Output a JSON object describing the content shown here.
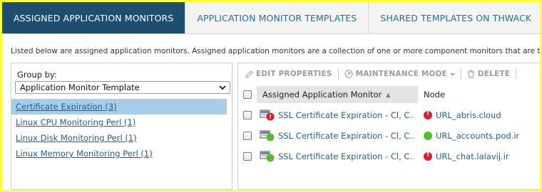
{
  "tabs": [
    {
      "label": "ASSIGNED APPLICATION MONITORS",
      "active": true
    },
    {
      "label": "APPLICATION MONITOR TEMPLATES",
      "active": false
    },
    {
      "label": "SHARED TEMPLATES ON THWACK",
      "active": false
    }
  ],
  "description": "Listed below are assigned application monitors. Assigned application monitors are a collection of one or more component monitors that are treat",
  "group_by": {
    "label": "Group by:",
    "selected": "Application Monitor Template",
    "items": [
      {
        "label": "Certificate Expiration (3)",
        "selected": true
      },
      {
        "label": "Linux CPU Monitoring Perl (1)",
        "selected": false
      },
      {
        "label": "Linux Disk Monitoring Perl (1)",
        "selected": false
      },
      {
        "label": "Linux Memory Monitoring Perl (1)",
        "selected": false
      }
    ]
  },
  "toolbar": {
    "edit_properties": "EDIT PROPERTIES",
    "maintenance_mode": "MAINTENANCE MODE",
    "delete": "DELETE"
  },
  "table": {
    "col_name": "Assigned Application Monitor",
    "col_node": "Node",
    "sort_indicator": "▲",
    "rows": [
      {
        "monitor": "SSL Certificate Expiration - Cl, C...",
        "monitor_status": "down",
        "node": "URL_abris.cloud",
        "node_status": "down"
      },
      {
        "monitor": "SSL Certificate Expiration - Cl, C...",
        "monitor_status": "up",
        "node": "URL_accounts.pod.ir",
        "node_status": "up"
      },
      {
        "monitor": "SSL Certificate Expiration - Cl, C...",
        "monitor_status": "up",
        "node": "URL_chat.lalavij.ir",
        "node_status": "down"
      }
    ]
  },
  "colors": {
    "active_tab": "#1d4e6f",
    "link": "#1f5f8b",
    "selected_row": "#a7cdea",
    "status_down": "#d8202a",
    "status_up": "#5cb82e",
    "highlight_border": "#ffff33"
  }
}
